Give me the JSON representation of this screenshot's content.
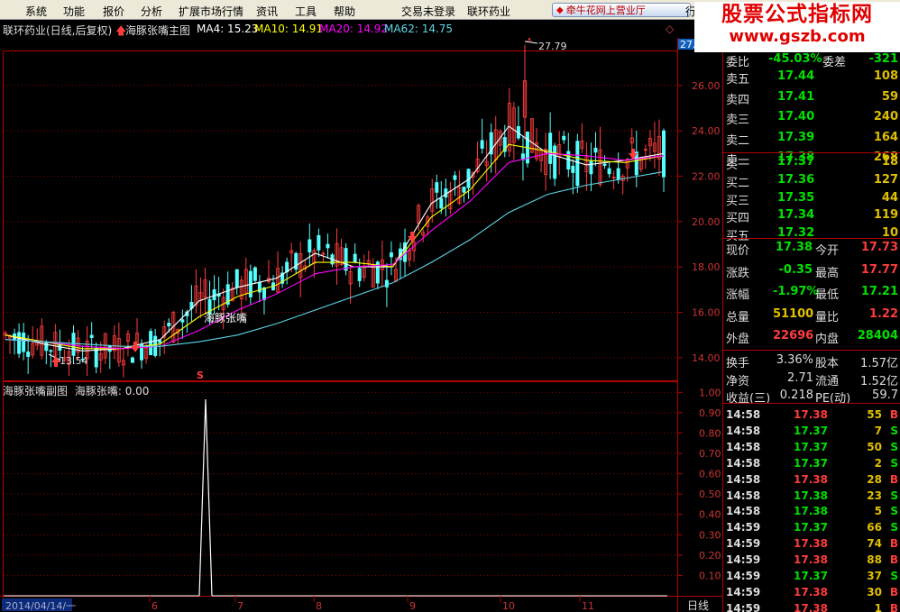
{
  "menu": [
    "系统",
    "功能",
    "报价",
    "分析",
    "扩展市场行情",
    "资讯",
    "工具",
    "帮助",
    "交易未登录",
    "联环药业"
  ],
  "broker_button": "牵牛花网上营业厅",
  "row_tail": "行",
  "watermark": {
    "line1": "股票公式指标网",
    "line2": "www.gszb.com"
  },
  "title": {
    "stock": "联环药业(日线,后复权)",
    "indicator_main": "海豚张嘴主图",
    "ma4": "MA4: 15.23",
    "ma10": "MA10: 14.91",
    "ma20": "MA20: 14.92",
    "ma62": "MA62: 14.75"
  },
  "indicator_sub": {
    "name": "海豚张嘴副图",
    "value": "海豚张嘴: 0.00"
  },
  "chart_labels": {
    "signal_text": "海豚张嘴",
    "high_marker": "27.79",
    "low_marker": "13.54",
    "s_marker": "S",
    "corner_diamond": "◇",
    "axis_partial": "27."
  },
  "colors": {
    "up": "#ff3c3c",
    "down": "#54ffff",
    "ma4": "#ffffff",
    "ma10": "#ffff00",
    "ma20": "#ff00ff",
    "ma62": "#5bd8e8",
    "grid": "#8b0000",
    "frame": "#b00000",
    "bid_ask_price": "#00e000",
    "volume": "#e0c000"
  },
  "chart_data": [
    {
      "type": "line",
      "name": "main-price-chart",
      "ylim": [
        13,
        27.5
      ],
      "yticks": [
        "26.00",
        "24.00",
        "22.00",
        "20.00",
        "18.00",
        "16.00",
        "14.00"
      ],
      "x_labels": [
        "2014/04/14/一",
        "6",
        "7",
        "8",
        "9",
        "10",
        "11"
      ],
      "series": [
        {
          "name": "MA4",
          "values": [
            15.0,
            14.6,
            14.3,
            14.4,
            14.8,
            16.5,
            17.1,
            17.5,
            18.6,
            18.0,
            18.0,
            20.8,
            21.9,
            24.2,
            23.0,
            22.5,
            22.7,
            23.0
          ]
        },
        {
          "name": "MA10",
          "values": [
            15.0,
            14.7,
            14.4,
            14.4,
            14.6,
            15.8,
            16.7,
            17.2,
            18.2,
            18.2,
            18.0,
            20.2,
            21.4,
            23.4,
            23.1,
            22.7,
            22.6,
            22.9
          ]
        },
        {
          "name": "MA20",
          "values": [
            14.8,
            14.7,
            14.5,
            14.4,
            14.5,
            15.2,
            16.1,
            16.8,
            17.7,
            18.0,
            18.1,
            19.6,
            20.9,
            22.6,
            23.0,
            22.9,
            22.7,
            22.9
          ]
        },
        {
          "name": "MA62",
          "values": [
            14.8,
            14.7,
            14.6,
            14.5,
            14.5,
            14.7,
            15.0,
            15.5,
            16.1,
            16.7,
            17.3,
            18.2,
            19.2,
            20.4,
            21.2,
            21.6,
            21.9,
            22.2
          ]
        }
      ]
    },
    {
      "type": "line",
      "name": "sub-indicator-chart",
      "ylim": [
        0,
        1.05
      ],
      "yticks": [
        "1.00",
        "0.90",
        "0.80",
        "0.70",
        "0.60",
        "0.50",
        "0.40",
        "0.30",
        "0.20",
        "0.10"
      ],
      "x_label": "日线",
      "series": [
        {
          "name": "海豚张嘴",
          "signal_at_index": 0.29,
          "values": [
            0,
            1,
            0
          ]
        }
      ]
    }
  ],
  "quote": {
    "header_partial": {
      "left": "委比",
      "left_val": "-45.03%",
      "right": "委差",
      "right_val": "-321"
    },
    "asks": [
      {
        "label": "卖五",
        "price": "17.44",
        "vol": "108"
      },
      {
        "label": "卖四",
        "price": "17.41",
        "vol": "59"
      },
      {
        "label": "卖三",
        "price": "17.40",
        "vol": "240"
      },
      {
        "label": "卖二",
        "price": "17.39",
        "vol": "164"
      },
      {
        "label": "卖一",
        "price": "17.38",
        "vol": "268"
      }
    ],
    "bids": [
      {
        "label": "买一",
        "price": "17.37",
        "vol": "18"
      },
      {
        "label": "买二",
        "price": "17.36",
        "vol": "127"
      },
      {
        "label": "买三",
        "price": "17.35",
        "vol": "44"
      },
      {
        "label": "买四",
        "price": "17.34",
        "vol": "119"
      },
      {
        "label": "买五",
        "price": "17.32",
        "vol": "10"
      }
    ],
    "stats": [
      {
        "l1": "现价",
        "v1": "17.38",
        "c1": "#00e000",
        "l2": "今开",
        "v2": "17.73",
        "c2": "#ff3c3c"
      },
      {
        "l1": "涨跌",
        "v1": "-0.35",
        "c1": "#00e000",
        "l2": "最高",
        "v2": "17.77",
        "c2": "#ff3c3c"
      },
      {
        "l1": "涨幅",
        "v1": "-1.97%",
        "c1": "#00e000",
        "l2": "最低",
        "v2": "17.21",
        "c2": "#00e000"
      },
      {
        "l1": "总量",
        "v1": "51100",
        "c1": "#e0c000",
        "l2": "量比",
        "v2": "1.22",
        "c2": "#ff3c3c"
      },
      {
        "l1": "外盘",
        "v1": "22696",
        "c1": "#ff3c3c",
        "l2": "内盘",
        "v2": "28404",
        "c2": "#00e000"
      }
    ],
    "fin": [
      {
        "l1": "换手",
        "v1": "3.36%",
        "l2": "股本",
        "v2": "1.57亿"
      },
      {
        "l1": "净资",
        "v1": "2.71",
        "l2": "流通",
        "v2": "1.52亿"
      },
      {
        "l1": "收益(三)",
        "v1": "0.218",
        "l2": "PE(动)",
        "v2": "59.7"
      }
    ],
    "ticks": [
      {
        "time": "14:58",
        "price": "17.38",
        "vol": "55",
        "side": "B"
      },
      {
        "time": "14:58",
        "price": "17.37",
        "vol": "7",
        "side": "S"
      },
      {
        "time": "14:58",
        "price": "17.37",
        "vol": "50",
        "side": "S"
      },
      {
        "time": "14:58",
        "price": "17.37",
        "vol": "2",
        "side": "S"
      },
      {
        "time": "14:58",
        "price": "17.38",
        "vol": "28",
        "side": "B"
      },
      {
        "time": "14:58",
        "price": "17.38",
        "vol": "23",
        "side": "S"
      },
      {
        "time": "14:58",
        "price": "17.38",
        "vol": "5",
        "side": "S"
      },
      {
        "time": "14:59",
        "price": "17.37",
        "vol": "66",
        "side": "S"
      },
      {
        "time": "14:59",
        "price": "17.38",
        "vol": "74",
        "side": "B"
      },
      {
        "time": "14:59",
        "price": "17.38",
        "vol": "88",
        "side": "B"
      },
      {
        "time": "14:59",
        "price": "17.37",
        "vol": "37",
        "side": "S"
      },
      {
        "time": "14:59",
        "price": "17.38",
        "vol": "30",
        "side": "B"
      },
      {
        "time": "14:59",
        "price": "17.38",
        "vol": "1",
        "side": "B"
      },
      {
        "time": "15:00",
        "price": "17.37",
        "vol": "31",
        "side": "S"
      }
    ]
  }
}
